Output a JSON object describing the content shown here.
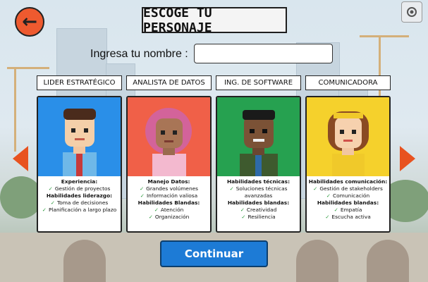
{
  "header": {
    "title": "ESCOGE TU PERSONAJE"
  },
  "name_prompt": {
    "label": "Ingresa tu nombre :",
    "value": ""
  },
  "characters": [
    {
      "role": "LIDER ESTRATÉGICO",
      "bg_color": "#2a8fe8",
      "lines": [
        {
          "text": "Experiencia:",
          "bold": true,
          "check": false
        },
        {
          "text": "Gestión de proyectos",
          "bold": false,
          "check": true
        },
        {
          "text": "Habilidades liderazgo:",
          "bold": true,
          "check": false
        },
        {
          "text": "Toma de decisiones",
          "bold": false,
          "check": true
        },
        {
          "text": "Planificación a largo plazo",
          "bold": false,
          "check": true
        }
      ]
    },
    {
      "role": "ANALISTA DE DATOS",
      "bg_color": "#f06048",
      "lines": [
        {
          "text": "Manejo Datos:",
          "bold": true,
          "check": false
        },
        {
          "text": "Grandes volúmenes",
          "bold": false,
          "check": true
        },
        {
          "text": "Información valiosa",
          "bold": false,
          "check": true
        },
        {
          "text": "Habilidades Blandas:",
          "bold": true,
          "check": false
        },
        {
          "text": "Atención",
          "bold": false,
          "check": true
        },
        {
          "text": "Organización",
          "bold": false,
          "check": true
        }
      ]
    },
    {
      "role": "ING. DE SOFTWARE",
      "bg_color": "#26a150",
      "lines": [
        {
          "text": "Habilidades técnicas:",
          "bold": true,
          "check": false
        },
        {
          "text": "Soluciones técnicas avanzadas",
          "bold": false,
          "check": true
        },
        {
          "text": "Habilidades blandas:",
          "bold": true,
          "check": false
        },
        {
          "text": "Creatividad",
          "bold": false,
          "check": true
        },
        {
          "text": "Resiliencia",
          "bold": false,
          "check": true
        }
      ]
    },
    {
      "role": "COMUNICADORA",
      "bg_color": "#f5d12c",
      "lines": [
        {
          "text": "Habilidades comunicación:",
          "bold": true,
          "check": false
        },
        {
          "text": "Gestión de stakeholders",
          "bold": false,
          "check": true
        },
        {
          "text": "Comunicación",
          "bold": false,
          "check": true
        },
        {
          "text": "Habilidades blandas:",
          "bold": true,
          "check": false
        },
        {
          "text": "Empatía",
          "bold": false,
          "check": true
        },
        {
          "text": "Escucha activa",
          "bold": false,
          "check": true
        }
      ]
    }
  ],
  "continue_label": "Continuar",
  "icons": {
    "back": "arrow-left-icon",
    "settings": "settings-icon",
    "prev": "arrow-left-icon",
    "next": "arrow-right-icon"
  }
}
